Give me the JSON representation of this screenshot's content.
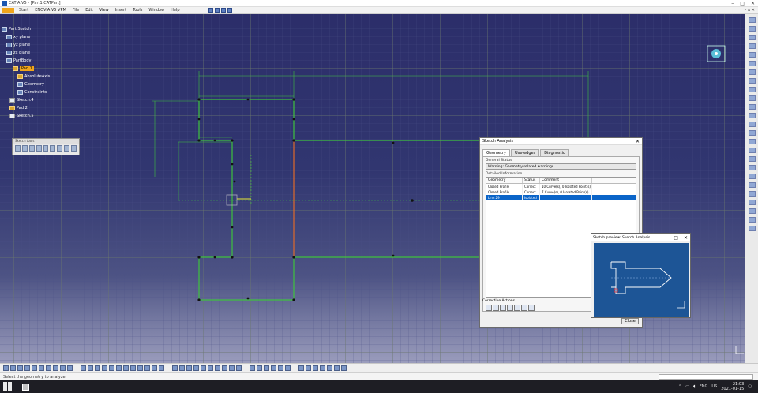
{
  "window": {
    "title": "CATIA V5 - [Part1.CATPart]",
    "controls": [
      "–",
      "□",
      "✕"
    ]
  },
  "menubar": {
    "items": [
      "Start",
      "ENOVIA V5 VPM",
      "File",
      "Edit",
      "View",
      "Insert",
      "Tools",
      "Window",
      "Help"
    ],
    "right": "– ▫ ✕"
  },
  "tree": {
    "items": [
      {
        "label": "Part Sketch",
        "icon": "part-icon",
        "indent": 0
      },
      {
        "label": "xy plane",
        "icon": "plane-icon",
        "indent": 1
      },
      {
        "label": "yz plane",
        "icon": "plane-icon",
        "indent": 1
      },
      {
        "label": "zx plane",
        "icon": "plane-icon",
        "indent": 1
      },
      {
        "label": "PartBody",
        "icon": "body-icon",
        "indent": 1
      },
      {
        "label": "Pad.1",
        "icon": "pad-icon",
        "indent": 2,
        "selected": true
      },
      {
        "label": "AbsoluteAxis",
        "icon": "axis-icon",
        "indent": 3
      },
      {
        "label": "Geometry",
        "icon": "geometry-icon",
        "indent": 3
      },
      {
        "label": "Constraints",
        "icon": "constraints-icon",
        "indent": 3
      },
      {
        "label": "Sketch.4",
        "icon": "sketch-icon",
        "indent": 2
      },
      {
        "label": "Pad.2",
        "icon": "pad-icon",
        "indent": 2
      },
      {
        "label": "Sketch.5",
        "icon": "sketch-icon",
        "indent": 2
      }
    ]
  },
  "float_toolbar": {
    "title": "Sketch tools"
  },
  "sketch_analysis": {
    "title": "Sketch Analysis",
    "close_x": "✕",
    "tabs": [
      "Geometry",
      "Use-edges",
      "Diagnostic"
    ],
    "general_status_label": "General Status",
    "general_status_value": "Warning: Geometry-related warnings",
    "detailed_info_label": "Detailed Information",
    "columns": [
      "Geometry",
      "Status",
      "Comment"
    ],
    "rows": [
      {
        "geometry": "Closed Profile",
        "status": "Correct",
        "comment": "10 Curve(s), 0 Isolated Point(s)",
        "selected": false
      },
      {
        "geometry": "Closed Profile",
        "status": "Correct",
        "comment": "7 Curve(s), 0 Isolated Point(s)",
        "selected": false
      },
      {
        "geometry": "Line.29",
        "status": "Isolated",
        "comment": "",
        "selected": true
      }
    ],
    "corrective_label": "Corrective Actions",
    "close_button": "Close"
  },
  "preview": {
    "title": "Sketch preview: Sketch Analysis",
    "controls": [
      "–",
      "□",
      "✕"
    ]
  },
  "statusbar": {
    "text": "Select the geometry to analyze"
  },
  "taskbar": {
    "tray_lang": "ENG",
    "tray_region": "US",
    "time": "21:03",
    "date": "2021-01-15"
  },
  "colors": {
    "sketch_line": "#3ec23e",
    "canvas_top": "#2c2e6a",
    "selection_blue": "#0a64c8",
    "tree_highlight": "#f0a51c"
  }
}
